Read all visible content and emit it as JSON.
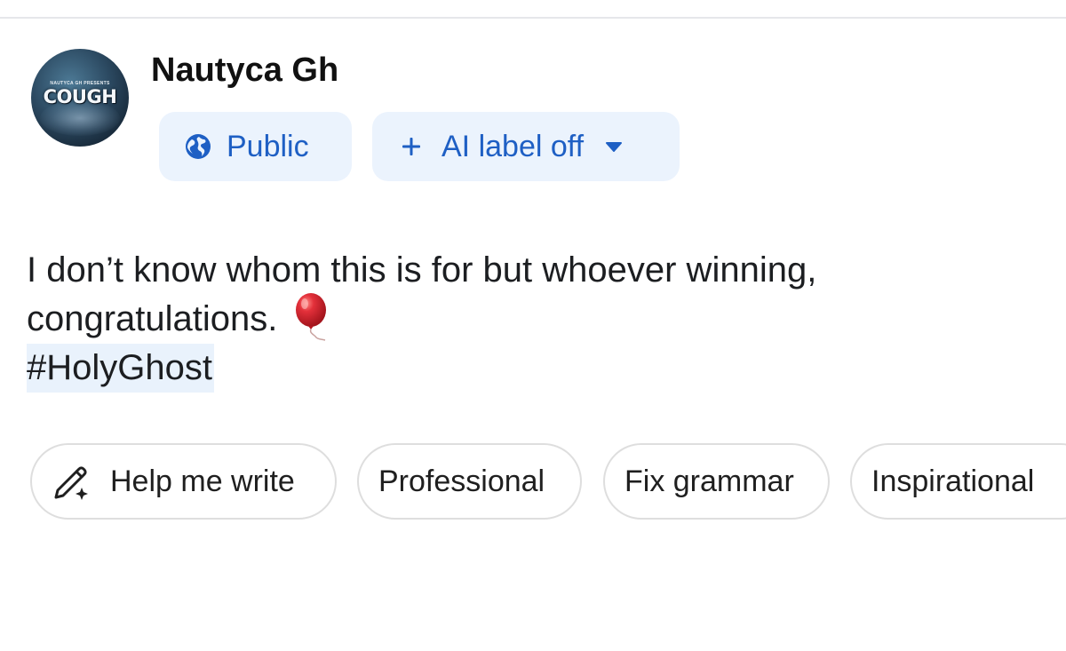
{
  "post": {
    "author": {
      "name": "Nautyca Gh",
      "avatar_text": "COUGH",
      "avatar_small_text": "NAUTYCA GH PRESENTS"
    },
    "audience_chip": {
      "label": "Public",
      "icon": "globe-icon"
    },
    "ai_label_chip": {
      "label": "AI label off",
      "prefix_icon": "plus-icon",
      "suffix_icon": "caret-down-icon"
    },
    "body": {
      "line1": "I don’t know whom this is for but whoever winning,",
      "line2": "congratulations.",
      "emoji": "balloon",
      "hashtag": "#HolyGhost"
    }
  },
  "actions": {
    "help_me_write": "Help me write",
    "professional": "Professional",
    "fix_grammar": "Fix grammar",
    "inspirational": "Inspirational"
  },
  "colors": {
    "accent_blue": "#1e5fc4",
    "chip_background": "#ebf3fd",
    "pill_border": "#dedede",
    "balloon_red": "#d8202a"
  }
}
